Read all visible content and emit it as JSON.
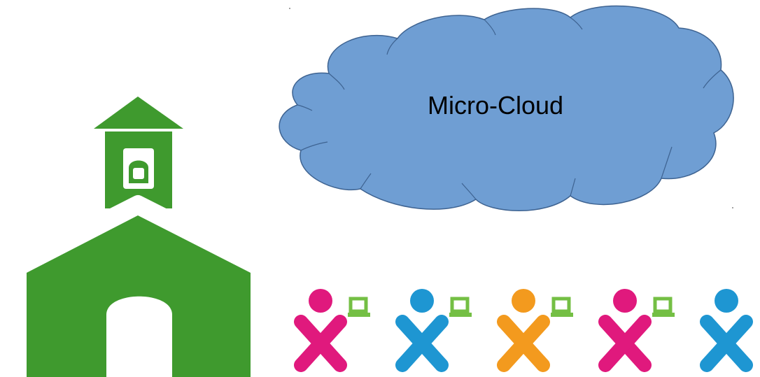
{
  "cloud": {
    "label": "Micro-Cloud",
    "fill_color": "#6f9ed3",
    "stroke_color": "#3e6391"
  },
  "school": {
    "icon": "schoolhouse-icon",
    "color": "#3f9a2e"
  },
  "children": [
    {
      "icon": "xo-child-laptop-icon",
      "child_color": "#e0197d",
      "laptop_color": "#74bf44",
      "has_laptop": true
    },
    {
      "icon": "xo-child-laptop-icon",
      "child_color": "#1e96d2",
      "laptop_color": "#74bf44",
      "has_laptop": true
    },
    {
      "icon": "xo-child-laptop-icon",
      "child_color": "#f39a1e",
      "laptop_color": "#74bf44",
      "has_laptop": true
    },
    {
      "icon": "xo-child-laptop-icon",
      "child_color": "#e0197d",
      "laptop_color": "#74bf44",
      "has_laptop": true
    },
    {
      "icon": "xo-child-icon",
      "child_color": "#1e96d2",
      "laptop_color": "#74bf44",
      "has_laptop": false
    }
  ]
}
